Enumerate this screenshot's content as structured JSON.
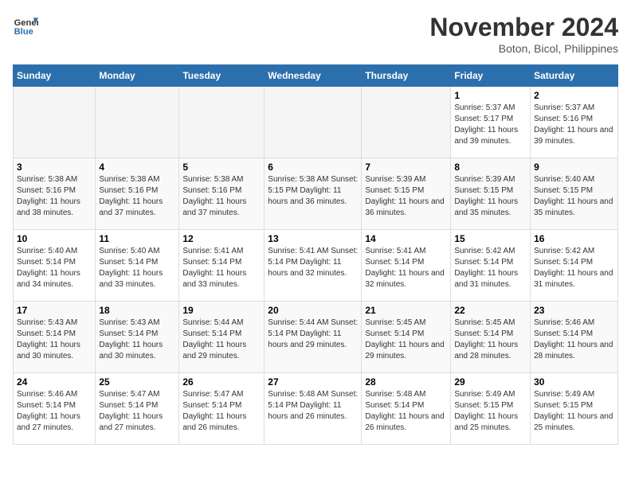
{
  "logo": {
    "line1": "General",
    "line2": "Blue"
  },
  "title": "November 2024",
  "location": "Boton, Bicol, Philippines",
  "weekdays": [
    "Sunday",
    "Monday",
    "Tuesday",
    "Wednesday",
    "Thursday",
    "Friday",
    "Saturday"
  ],
  "weeks": [
    [
      {
        "day": "",
        "info": ""
      },
      {
        "day": "",
        "info": ""
      },
      {
        "day": "",
        "info": ""
      },
      {
        "day": "",
        "info": ""
      },
      {
        "day": "",
        "info": ""
      },
      {
        "day": "1",
        "info": "Sunrise: 5:37 AM\nSunset: 5:17 PM\nDaylight: 11 hours and 39 minutes."
      },
      {
        "day": "2",
        "info": "Sunrise: 5:37 AM\nSunset: 5:16 PM\nDaylight: 11 hours and 39 minutes."
      }
    ],
    [
      {
        "day": "3",
        "info": "Sunrise: 5:38 AM\nSunset: 5:16 PM\nDaylight: 11 hours and 38 minutes."
      },
      {
        "day": "4",
        "info": "Sunrise: 5:38 AM\nSunset: 5:16 PM\nDaylight: 11 hours and 37 minutes."
      },
      {
        "day": "5",
        "info": "Sunrise: 5:38 AM\nSunset: 5:16 PM\nDaylight: 11 hours and 37 minutes."
      },
      {
        "day": "6",
        "info": "Sunrise: 5:38 AM\nSunset: 5:15 PM\nDaylight: 11 hours and 36 minutes."
      },
      {
        "day": "7",
        "info": "Sunrise: 5:39 AM\nSunset: 5:15 PM\nDaylight: 11 hours and 36 minutes."
      },
      {
        "day": "8",
        "info": "Sunrise: 5:39 AM\nSunset: 5:15 PM\nDaylight: 11 hours and 35 minutes."
      },
      {
        "day": "9",
        "info": "Sunrise: 5:40 AM\nSunset: 5:15 PM\nDaylight: 11 hours and 35 minutes."
      }
    ],
    [
      {
        "day": "10",
        "info": "Sunrise: 5:40 AM\nSunset: 5:14 PM\nDaylight: 11 hours and 34 minutes."
      },
      {
        "day": "11",
        "info": "Sunrise: 5:40 AM\nSunset: 5:14 PM\nDaylight: 11 hours and 33 minutes."
      },
      {
        "day": "12",
        "info": "Sunrise: 5:41 AM\nSunset: 5:14 PM\nDaylight: 11 hours and 33 minutes."
      },
      {
        "day": "13",
        "info": "Sunrise: 5:41 AM\nSunset: 5:14 PM\nDaylight: 11 hours and 32 minutes."
      },
      {
        "day": "14",
        "info": "Sunrise: 5:41 AM\nSunset: 5:14 PM\nDaylight: 11 hours and 32 minutes."
      },
      {
        "day": "15",
        "info": "Sunrise: 5:42 AM\nSunset: 5:14 PM\nDaylight: 11 hours and 31 minutes."
      },
      {
        "day": "16",
        "info": "Sunrise: 5:42 AM\nSunset: 5:14 PM\nDaylight: 11 hours and 31 minutes."
      }
    ],
    [
      {
        "day": "17",
        "info": "Sunrise: 5:43 AM\nSunset: 5:14 PM\nDaylight: 11 hours and 30 minutes."
      },
      {
        "day": "18",
        "info": "Sunrise: 5:43 AM\nSunset: 5:14 PM\nDaylight: 11 hours and 30 minutes."
      },
      {
        "day": "19",
        "info": "Sunrise: 5:44 AM\nSunset: 5:14 PM\nDaylight: 11 hours and 29 minutes."
      },
      {
        "day": "20",
        "info": "Sunrise: 5:44 AM\nSunset: 5:14 PM\nDaylight: 11 hours and 29 minutes."
      },
      {
        "day": "21",
        "info": "Sunrise: 5:45 AM\nSunset: 5:14 PM\nDaylight: 11 hours and 29 minutes."
      },
      {
        "day": "22",
        "info": "Sunrise: 5:45 AM\nSunset: 5:14 PM\nDaylight: 11 hours and 28 minutes."
      },
      {
        "day": "23",
        "info": "Sunrise: 5:46 AM\nSunset: 5:14 PM\nDaylight: 11 hours and 28 minutes."
      }
    ],
    [
      {
        "day": "24",
        "info": "Sunrise: 5:46 AM\nSunset: 5:14 PM\nDaylight: 11 hours and 27 minutes."
      },
      {
        "day": "25",
        "info": "Sunrise: 5:47 AM\nSunset: 5:14 PM\nDaylight: 11 hours and 27 minutes."
      },
      {
        "day": "26",
        "info": "Sunrise: 5:47 AM\nSunset: 5:14 PM\nDaylight: 11 hours and 26 minutes."
      },
      {
        "day": "27",
        "info": "Sunrise: 5:48 AM\nSunset: 5:14 PM\nDaylight: 11 hours and 26 minutes."
      },
      {
        "day": "28",
        "info": "Sunrise: 5:48 AM\nSunset: 5:14 PM\nDaylight: 11 hours and 26 minutes."
      },
      {
        "day": "29",
        "info": "Sunrise: 5:49 AM\nSunset: 5:15 PM\nDaylight: 11 hours and 25 minutes."
      },
      {
        "day": "30",
        "info": "Sunrise: 5:49 AM\nSunset: 5:15 PM\nDaylight: 11 hours and 25 minutes."
      }
    ]
  ]
}
